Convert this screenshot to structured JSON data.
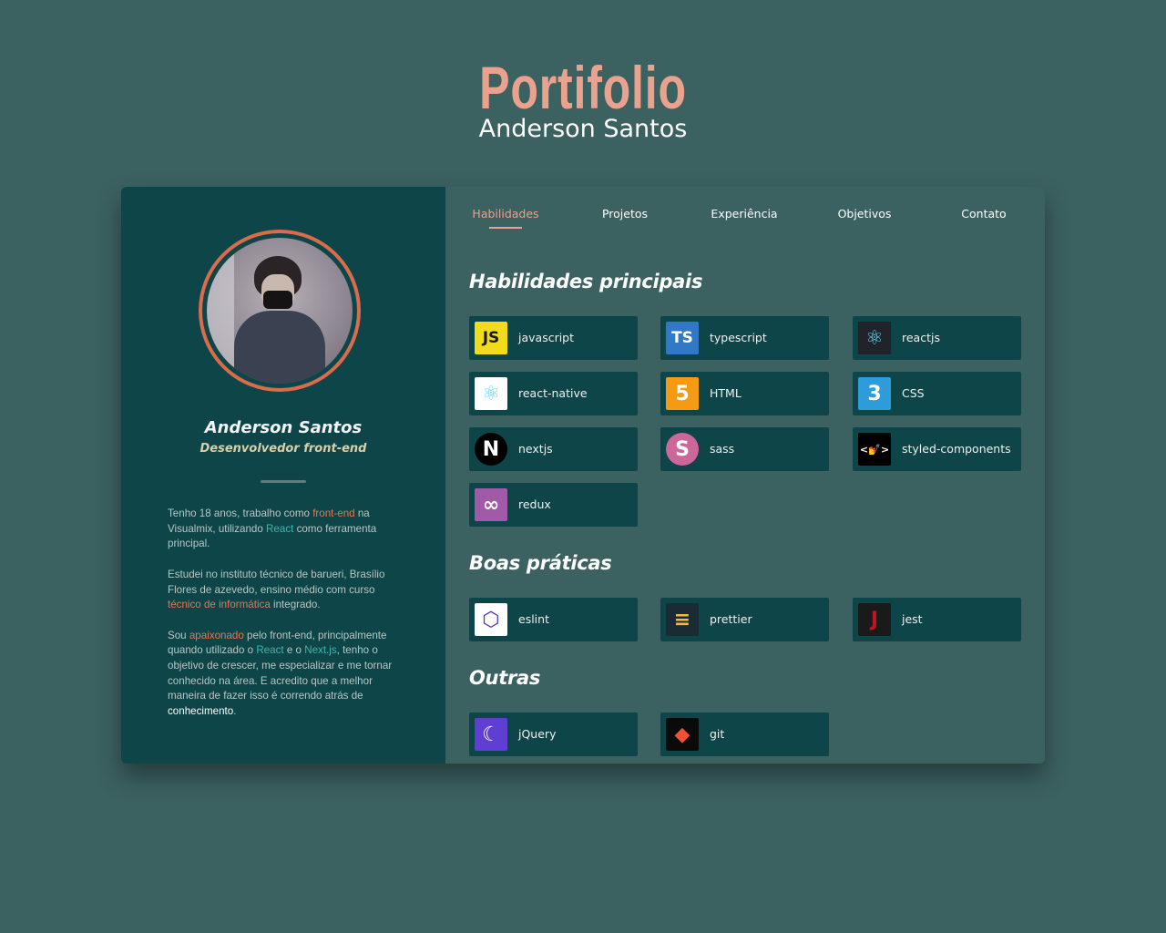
{
  "hero": {
    "title": "Portifolio",
    "name": "Anderson Santos"
  },
  "profile": {
    "name": "Anderson Santos",
    "role": "Desenvolvedor front-end",
    "bio": [
      [
        {
          "t": "Tenho 18 anos, trabalho como ",
          "c": ""
        },
        {
          "t": "front-end",
          "c": "orange"
        },
        {
          "t": " na Visualmix, utilizando ",
          "c": ""
        },
        {
          "t": "React",
          "c": "teal"
        },
        {
          "t": " como ferramenta principal.",
          "c": ""
        }
      ],
      [
        {
          "t": "Estudei no instituto técnico de barueri, Brasílio Flores de azevedo, ensino médio com curso ",
          "c": ""
        },
        {
          "t": "técnico de informática",
          "c": "orange"
        },
        {
          "t": " integrado.",
          "c": ""
        }
      ],
      [
        {
          "t": "Sou ",
          "c": ""
        },
        {
          "t": "apaixonado",
          "c": "orange"
        },
        {
          "t": " pelo front-end, principalmente quando utilizado o ",
          "c": ""
        },
        {
          "t": "React",
          "c": "teal"
        },
        {
          "t": " e o ",
          "c": ""
        },
        {
          "t": "Next.js",
          "c": "teal"
        },
        {
          "t": ", tenho o objetivo de crescer, me especializar e me tornar conhecido na área. E acredito que a melhor maneira de fazer isso é correndo atrás de ",
          "c": ""
        },
        {
          "t": "conhecimento",
          "c": "white"
        },
        {
          "t": ".",
          "c": ""
        }
      ]
    ]
  },
  "tabs": [
    {
      "label": "Habilidades",
      "active": true
    },
    {
      "label": "Projetos",
      "active": false
    },
    {
      "label": "Experiência",
      "active": false
    },
    {
      "label": "Objetivos",
      "active": false
    },
    {
      "label": "Contato",
      "active": false
    }
  ],
  "sections": [
    {
      "title": "Habilidades principais",
      "skills": [
        {
          "label": "javascript",
          "icon": "javascript-icon",
          "glyph": "JS",
          "bg": "#f0db1c",
          "fg": "#1a1a1a"
        },
        {
          "label": "typescript",
          "icon": "typescript-icon",
          "glyph": "TS",
          "bg": "#3178c6",
          "fg": "#ffffff"
        },
        {
          "label": "reactjs",
          "icon": "react-icon",
          "glyph": "⚛",
          "bg": "#20232a",
          "fg": "#61dafb"
        },
        {
          "label": "react-native",
          "icon": "react-native-icon",
          "glyph": "⚛",
          "bg": "#ffffff",
          "fg": "#61dafb"
        },
        {
          "label": "HTML",
          "icon": "html5-icon",
          "glyph": "5",
          "bg": "#f59a12",
          "fg": "#ffffff"
        },
        {
          "label": "CSS",
          "icon": "css3-icon",
          "glyph": "3",
          "bg": "#2d9cdb",
          "fg": "#ffffff"
        },
        {
          "label": "nextjs",
          "icon": "nextjs-icon",
          "glyph": "N",
          "bg": "#000000",
          "fg": "#ffffff"
        },
        {
          "label": "sass",
          "icon": "sass-icon",
          "glyph": "S",
          "bg": "#cd6799",
          "fg": "#ffffff"
        },
        {
          "label": "styled-components",
          "icon": "styled-components-icon",
          "glyph": "<💅>",
          "bg": "#000000",
          "fg": "#ffffff"
        },
        {
          "label": "redux",
          "icon": "redux-icon",
          "glyph": "∞",
          "bg": "#a15aa7",
          "fg": "#ffffff"
        }
      ]
    },
    {
      "title": "Boas práticas",
      "skills": [
        {
          "label": "eslint",
          "icon": "eslint-icon",
          "glyph": "⬡",
          "bg": "#ffffff",
          "fg": "#4b32c3"
        },
        {
          "label": "prettier",
          "icon": "prettier-icon",
          "glyph": "≡",
          "bg": "#1a2b34",
          "fg": "#f7b93e"
        },
        {
          "label": "jest",
          "icon": "jest-icon",
          "glyph": "J",
          "bg": "#1a1a1a",
          "fg": "#c21325"
        }
      ]
    },
    {
      "title": "Outras",
      "skills": [
        {
          "label": "jQuery",
          "icon": "jquery-icon",
          "glyph": "☾",
          "bg": "#5f3fd3",
          "fg": "#ffffff"
        },
        {
          "label": "git",
          "icon": "git-icon",
          "glyph": "◆",
          "bg": "#0a0a0a",
          "fg": "#f05133"
        }
      ]
    }
  ]
}
